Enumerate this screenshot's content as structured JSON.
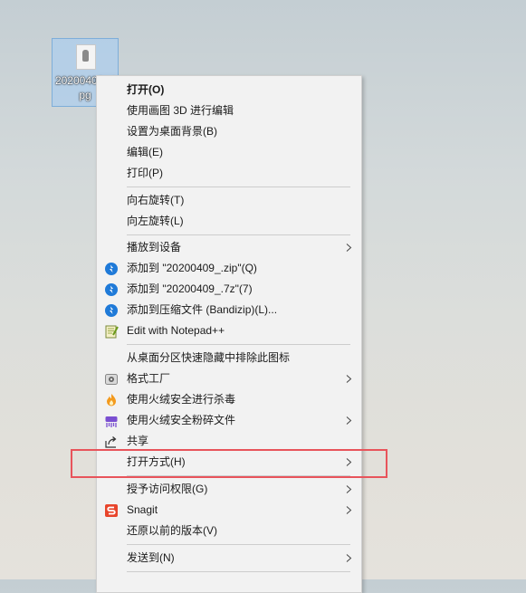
{
  "desktop_icon": {
    "filename": "20200409_.jpg"
  },
  "menu": {
    "groups": [
      [
        {
          "label": "打开(O)"
        },
        {
          "label": "使用画图 3D 进行编辑"
        },
        {
          "label": "设置为桌面背景(B)"
        },
        {
          "label": "编辑(E)"
        },
        {
          "label": "打印(P)"
        }
      ],
      [
        {
          "label": "向右旋转(T)"
        },
        {
          "label": "向左旋转(L)"
        }
      ],
      [
        {
          "label": "播放到设备"
        },
        {
          "label": "添加到 \"20200409_.zip\"(Q)",
          "icon": "bandizip-icon"
        },
        {
          "label": "添加到 \"20200409_.7z\"(7)",
          "icon": "bandizip-icon"
        },
        {
          "label": "添加到压缩文件 (Bandizip)(L)...",
          "icon": "bandizip-icon"
        },
        {
          "label": "Edit with Notepad++",
          "icon": "notepad-plus-plus-icon"
        }
      ],
      [
        {
          "label": "从桌面分区快速隐藏中排除此图标"
        },
        {
          "label": "格式工厂",
          "icon": "format-factory-icon"
        },
        {
          "label": "使用火绒安全进行杀毒",
          "icon": "huorong-antivirus-icon"
        },
        {
          "label": "使用火绒安全粉碎文件",
          "icon": "huorong-shredder-icon"
        },
        {
          "label": "共享",
          "icon": "share-icon"
        },
        {
          "label": "打开方式(H)"
        }
      ],
      [
        {
          "label": "授予访问权限(G)"
        },
        {
          "label": "Snagit",
          "icon": "snagit-icon"
        },
        {
          "label": "还原以前的版本(V)"
        }
      ],
      [
        {
          "label": "发送到(N)"
        }
      ]
    ]
  },
  "colors": {
    "highlight_border": "#e8545b",
    "bandizip_blue": "#1f7ad8",
    "snagit_red": "#e8452c",
    "huorong_orange": "#f39a1e",
    "huorong_purple": "#7a4fd1"
  }
}
